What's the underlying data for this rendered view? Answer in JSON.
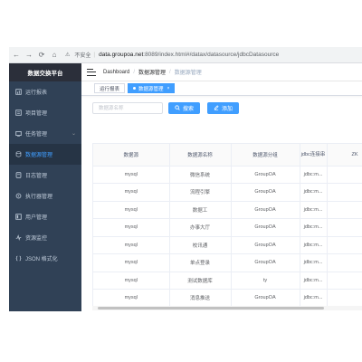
{
  "browser": {
    "insecure_label": "不安全",
    "url_host": "data.groupoa.net",
    "url_rest": ":8089/index.html#/datax/datasource/jdbcDatasource"
  },
  "sidebar": {
    "title": "数据交换平台",
    "items": [
      {
        "label": "运行报表",
        "icon": "report-icon"
      },
      {
        "label": "项目管理",
        "icon": "project-icon"
      },
      {
        "label": "任务管理",
        "icon": "task-icon"
      },
      {
        "label": "数据源管理",
        "icon": "datasource-icon"
      },
      {
        "label": "日志管理",
        "icon": "log-icon"
      },
      {
        "label": "执行器管理",
        "icon": "executor-icon"
      },
      {
        "label": "用户管理",
        "icon": "user-icon"
      },
      {
        "label": "资源监控",
        "icon": "monitor-icon"
      },
      {
        "label": "JSON 格式化",
        "icon": "json-icon"
      }
    ],
    "active_index": 3
  },
  "navbar": {
    "breadcrumbs": [
      "Dashboard",
      "数据源管理",
      "数据源管理"
    ]
  },
  "tags": [
    {
      "label": "运行报表"
    },
    {
      "label": "数据源管理",
      "close": "×"
    }
  ],
  "toolbar": {
    "search_placeholder": "数据源名称",
    "search_label": "搜索",
    "add_label": "添加"
  },
  "table": {
    "headers": [
      "数据源",
      "数据源名称",
      "数据源分组",
      "jdbc连接串",
      "ZK"
    ],
    "rows": [
      [
        "mysql",
        "微信系统",
        "GroupOA",
        "jdbc:m..."
      ],
      [
        "mysql",
        "流程引擎",
        "GroupOA",
        "jdbc:m..."
      ],
      [
        "mysql",
        "数据工",
        "GroupOA",
        "jdbc:m..."
      ],
      [
        "mysql",
        "办事大厅",
        "GroupOA",
        "jdbc:m..."
      ],
      [
        "mysql",
        "校讯通",
        "GroupOA",
        "jdbc:m..."
      ],
      [
        "mysql",
        "单点登录",
        "GroupOA",
        "jdbc:m..."
      ],
      [
        "mysql",
        "测试数据库",
        "ty",
        "jdbc:m..."
      ],
      [
        "mysql",
        "消息推送",
        "GroupOA",
        "jdbc:m..."
      ]
    ]
  },
  "colors": {
    "sidebar_bg": "#304156",
    "accent": "#409eff",
    "menu_text": "#bfcbd9"
  }
}
